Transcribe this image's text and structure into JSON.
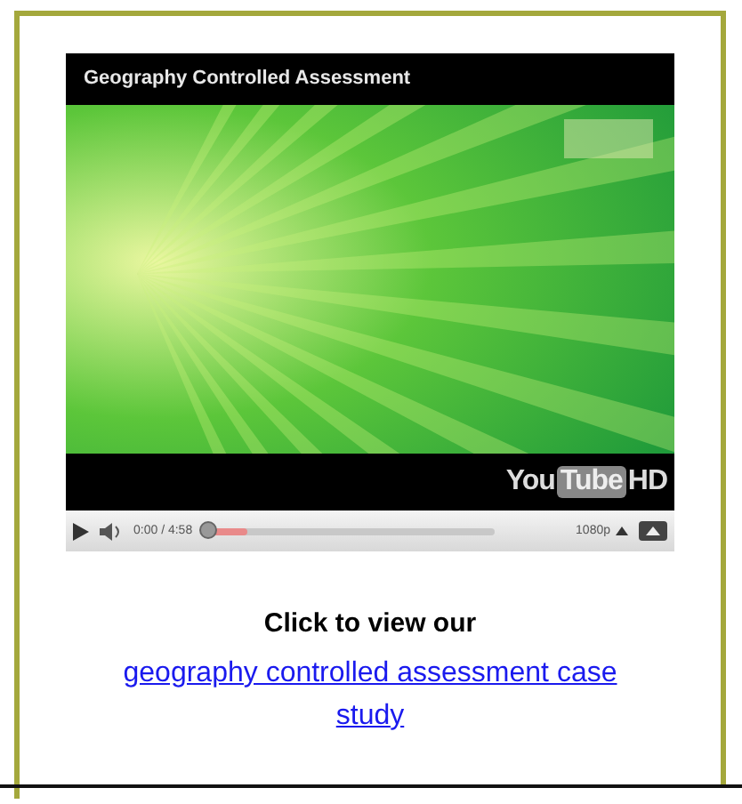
{
  "video": {
    "title": "Geography Controlled Assessment",
    "logo": {
      "left": "You",
      "boxed": "Tube",
      "suffix": "HD"
    },
    "controls": {
      "time": "0:00 / 4:58",
      "seek_bar": {
        "level": 0.15
      },
      "quality": "1080p"
    }
  },
  "caption": {
    "heading": "Click to view our",
    "link": "geography controlled assessment case study"
  }
}
